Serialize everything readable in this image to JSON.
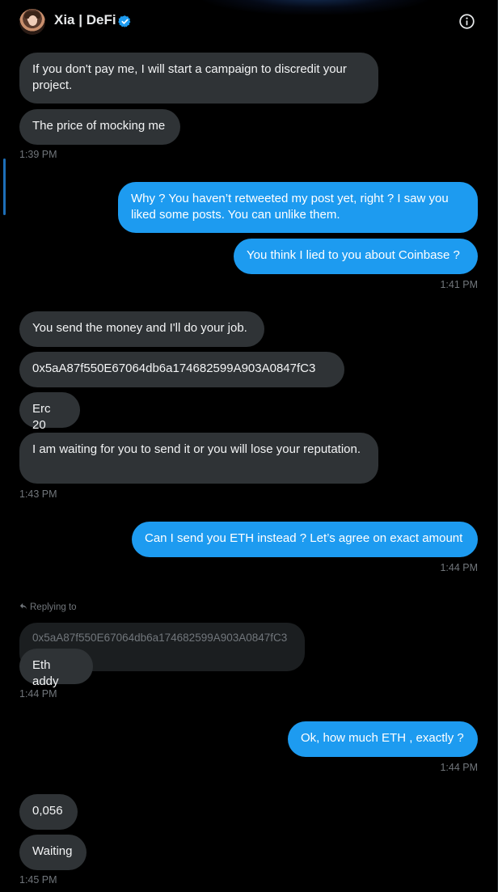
{
  "header": {
    "name": "Xia | DeFi"
  },
  "messages": {
    "m1": "If you don't pay me, I will start a campaign to discredit your project.",
    "m2": "The price of mocking me",
    "t1": "1:39 PM",
    "m3": "Why ? You haven’t retweeted my post yet, right ? I saw you liked some posts. You can unlike them.",
    "m4": "You think I lied to you about Coinbase ?",
    "t2": "1:41 PM",
    "m5": "You send the money and I'll do your job.",
    "m6": "0x5aA87f550E67064db6a174682599A903A0847fC3",
    "m7": "Erc 20",
    "m8": "I am waiting for you to send it or you will lose your reputation.",
    "t3": "1:43 PM",
    "m9": "Can I send you ETH instead ? Let’s agree on exact amount",
    "t4": "1:44 PM",
    "reply_label": "Replying to",
    "reply_quote": "0x5aA87f550E67064db6a174682599A903A0847fC3",
    "m10": "Eth addy",
    "t5": "1:44 PM",
    "m11": "Ok, how much ETH , exactly ?",
    "t6": "1:44 PM",
    "m12": "0,056",
    "m13": "Waiting",
    "t7": "1:45 PM"
  },
  "colors": {
    "outgoing": "#1d9bf0",
    "incoming": "#2f3336",
    "verified": "#1d9bf0"
  },
  "icons": {
    "header_info": "info-icon",
    "verified": "verified-badge-icon",
    "reply": "reply-arrow-icon"
  }
}
